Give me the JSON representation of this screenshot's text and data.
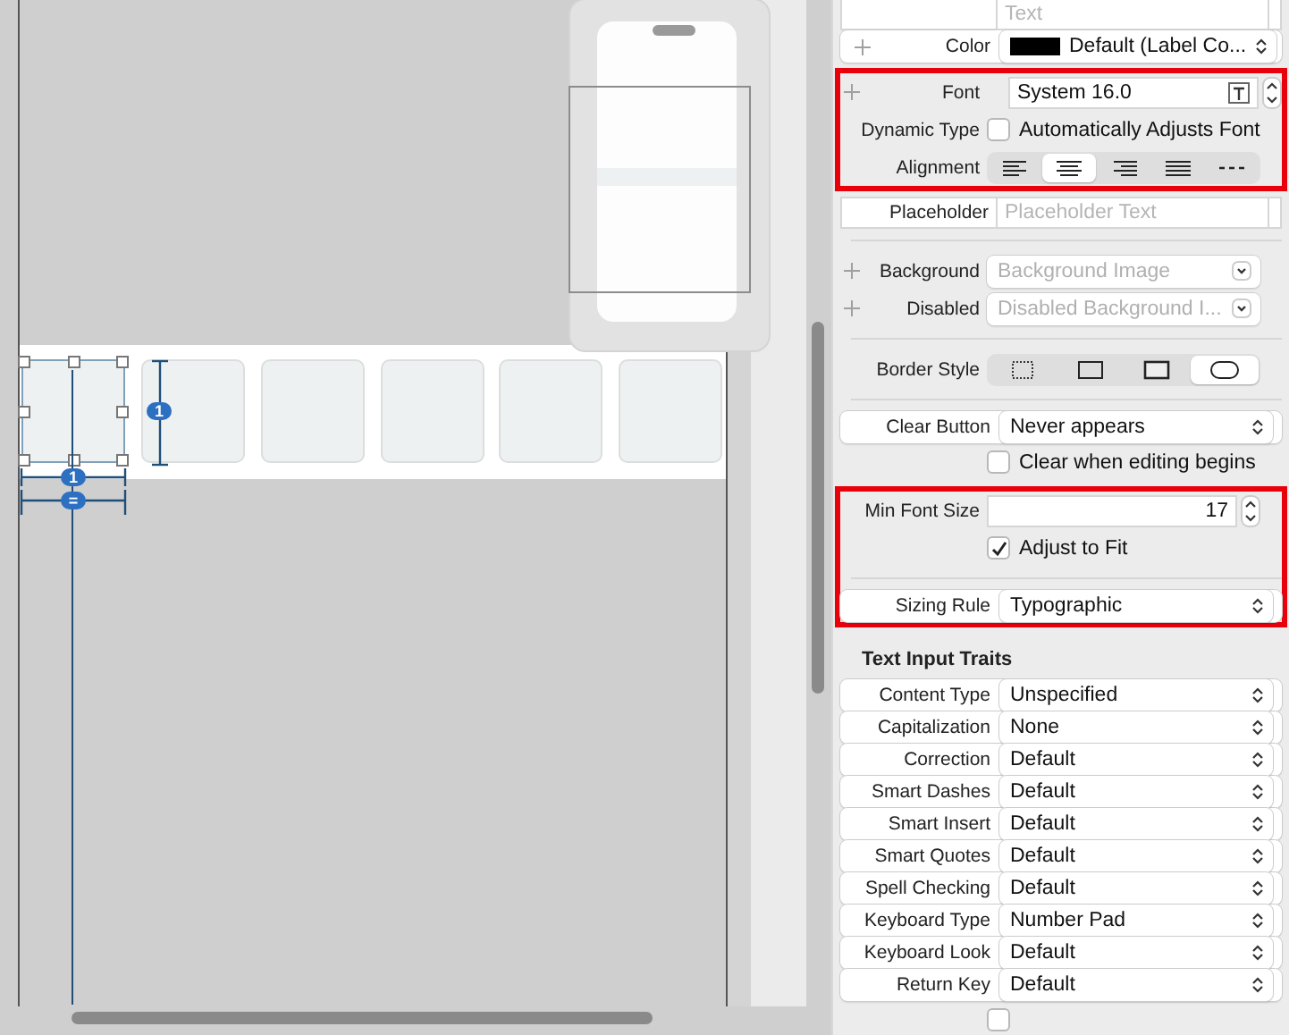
{
  "canvas": {
    "cells": [
      {
        "selected": true
      },
      {
        "selected": false
      },
      {
        "selected": false
      },
      {
        "selected": false
      },
      {
        "selected": false
      },
      {
        "selected": false
      }
    ],
    "badges": [
      {
        "kind": "height",
        "text": "1"
      },
      {
        "kind": "width",
        "text": "1"
      },
      {
        "kind": "equal",
        "text": "="
      }
    ]
  },
  "inspector": {
    "sections": [
      {
        "highlighted": false,
        "rows": [
          {
            "kind": "field",
            "placeholder": "Text"
          },
          {
            "kind": "popup",
            "label": "Color",
            "plus": true,
            "value": "Default (Label Co...",
            "swatch": true
          }
        ]
      },
      {
        "highlighted": true,
        "rows": [
          {
            "kind": "font",
            "label": "Font",
            "plus": true,
            "value": "System 16.0"
          },
          {
            "kind": "checkbox",
            "label": "Dynamic Type",
            "text": "Automatically Adjusts Font",
            "checked": false
          },
          {
            "kind": "segmented",
            "label": "Alignment",
            "segments": [
              {
                "kind": "left",
                "selected": false
              },
              {
                "kind": "center",
                "selected": true
              },
              {
                "kind": "right",
                "selected": false
              },
              {
                "kind": "justified",
                "selected": false
              },
              {
                "kind": "natural",
                "selected": false
              }
            ]
          }
        ]
      },
      {
        "highlighted": false,
        "rows": [
          {
            "kind": "field",
            "label": "Placeholder",
            "placeholder": "Placeholder Text"
          },
          {
            "kind": "divider"
          },
          {
            "kind": "combo",
            "label": "Background",
            "plus": true,
            "placeholder": "Background Image"
          },
          {
            "kind": "combo",
            "label": "Disabled",
            "plus": true,
            "placeholder": "Disabled Background I..."
          },
          {
            "kind": "divider"
          },
          {
            "kind": "segmented",
            "label": "Border Style",
            "segments": [
              {
                "kind": "none",
                "selected": false
              },
              {
                "kind": "line",
                "selected": false
              },
              {
                "kind": "bezel",
                "selected": false
              },
              {
                "kind": "rounded",
                "selected": true
              }
            ]
          },
          {
            "kind": "divider"
          },
          {
            "kind": "popup",
            "label": "Clear Button",
            "value": "Never appears"
          },
          {
            "kind": "checkbox",
            "text": "Clear when editing begins",
            "checked": false
          }
        ]
      },
      {
        "highlighted": true,
        "rows": [
          {
            "kind": "stepper",
            "label": "Min Font Size",
            "value": "17"
          },
          {
            "kind": "checkbox",
            "text": "Adjust to Fit",
            "checked": true
          },
          {
            "kind": "divider"
          },
          {
            "kind": "popup",
            "label": "Sizing Rule",
            "value": "Typographic"
          }
        ]
      },
      {
        "highlighted": false,
        "rows": [
          {
            "kind": "header",
            "text": "Text Input Traits"
          },
          {
            "kind": "popup",
            "label": "Content Type",
            "value": "Unspecified"
          },
          {
            "kind": "popup",
            "label": "Capitalization",
            "value": "None"
          },
          {
            "kind": "popup",
            "label": "Correction",
            "value": "Default"
          },
          {
            "kind": "popup",
            "label": "Smart Dashes",
            "value": "Default"
          },
          {
            "kind": "popup",
            "label": "Smart Insert",
            "value": "Default"
          },
          {
            "kind": "popup",
            "label": "Smart Quotes",
            "value": "Default"
          },
          {
            "kind": "popup",
            "label": "Spell Checking",
            "value": "Default"
          },
          {
            "kind": "popup",
            "label": "Keyboard Type",
            "value": "Number Pad"
          },
          {
            "kind": "popup",
            "label": "Keyboard Look",
            "value": "Default"
          },
          {
            "kind": "popup",
            "label": "Return Key",
            "value": "Default"
          },
          {
            "kind": "checkbox",
            "checked": false
          }
        ]
      }
    ]
  }
}
